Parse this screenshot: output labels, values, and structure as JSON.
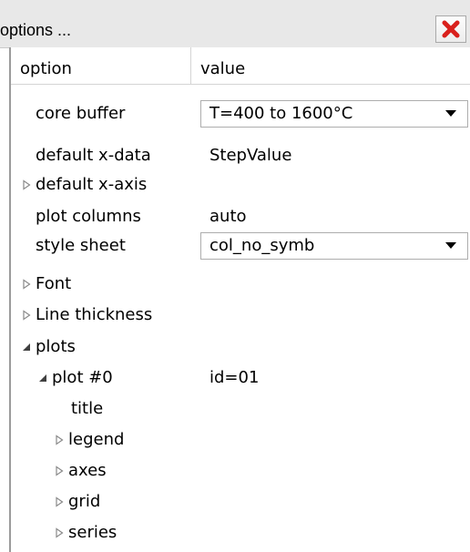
{
  "window": {
    "title": "options ..."
  },
  "header": {
    "option": "option",
    "value": "value"
  },
  "rows": {
    "core_buffer": {
      "label": "core buffer",
      "value": "T=400 to 1600°C"
    },
    "default_x_data": {
      "label": "default x-data",
      "value": "StepValue"
    },
    "default_x_axis": {
      "label": "default x-axis"
    },
    "plot_columns": {
      "label": "plot columns",
      "value": "auto"
    },
    "style_sheet": {
      "label": "style sheet",
      "value": "col_no_symb"
    },
    "font": {
      "label": "Font"
    },
    "line_thickness": {
      "label": "Line thickness"
    },
    "plots": {
      "label": "plots"
    },
    "plot0": {
      "label": "plot #0",
      "value": "id=01"
    },
    "title": {
      "label": "title"
    },
    "legend": {
      "label": "legend"
    },
    "axes": {
      "label": "axes"
    },
    "grid": {
      "label": "grid"
    },
    "series": {
      "label": "series"
    }
  },
  "icons": {
    "close": "close-icon",
    "collapsed": "triangle-right-outline-icon",
    "expanded": "triangle-down-filled-icon",
    "dropdown": "chevron-down-icon"
  },
  "colors": {
    "close_red": "#d9201c",
    "titlebar": "#e8e8e8"
  }
}
